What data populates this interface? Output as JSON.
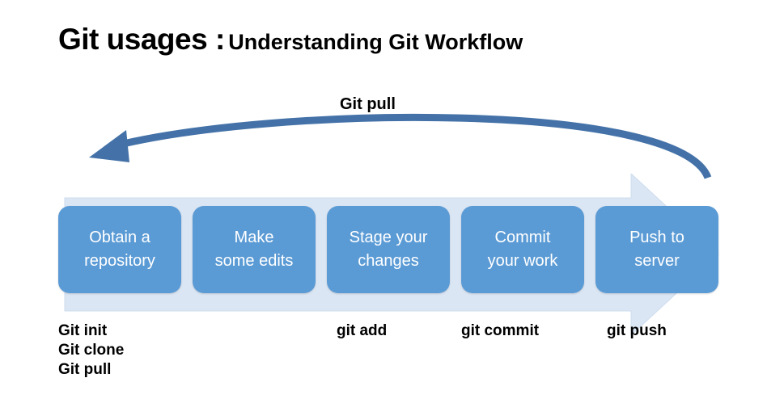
{
  "heading": {
    "strong": "Git usages :",
    "sub": "Understanding Git Workflow"
  },
  "pull_label": "Git pull",
  "steps": [
    {
      "line1": "Obtain a",
      "line2": "repository"
    },
    {
      "line1": "Make",
      "line2": "some edits"
    },
    {
      "line1": "Stage your",
      "line2": "changes"
    },
    {
      "line1": "Commit",
      "line2": "your work"
    },
    {
      "line1": "Push to",
      "line2": "server"
    }
  ],
  "labels": [
    "Git init\nGit clone\nGit pull",
    "",
    "git add",
    "git commit",
    "git push"
  ]
}
